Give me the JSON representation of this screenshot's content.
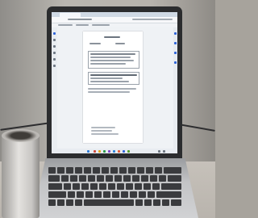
{
  "scene": {
    "description_terms": [
      "laptop",
      "coffee-mug",
      "desk",
      "wall"
    ]
  },
  "colors": {
    "accent_blue": "#2f64d8",
    "taskbar_icons": [
      "#d24a3a",
      "#2c7ad6",
      "#e3a51b",
      "#2a9c4a",
      "#7b45c9",
      "#2b83d8",
      "#e05a3a",
      "#2f64d8",
      "#4f9d2c"
    ]
  },
  "icons": {
    "left_rail": [
      "home-icon",
      "edit-icon",
      "comment-icon",
      "sign-icon",
      "search-icon",
      "gear-icon"
    ],
    "taskbar": [
      "start-icon",
      "search-icon",
      "files-icon",
      "browser-icon",
      "mail-icon",
      "store-icon",
      "office-icon",
      "pdf-icon",
      "chat-icon"
    ]
  }
}
